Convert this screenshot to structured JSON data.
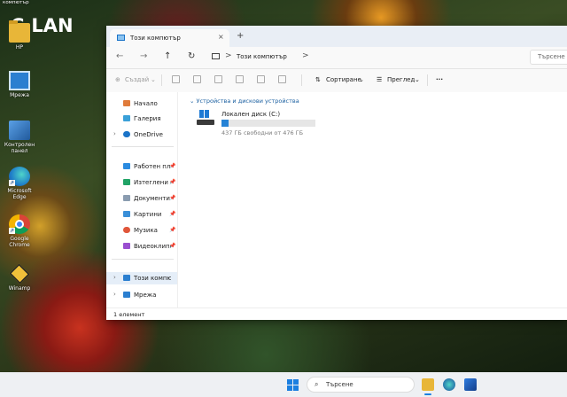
{
  "watermark": "C.LAN",
  "corner_label": "компютър",
  "desktop_icons": [
    {
      "label": "HP"
    },
    {
      "label": "Мрежа"
    },
    {
      "label": "Контролен панел"
    },
    {
      "label": "Microsoft Edge"
    },
    {
      "label": "Google Chrome"
    },
    {
      "label": "Winamp"
    }
  ],
  "window": {
    "tab_label": "Този компютър",
    "tab_close": "×",
    "tab_add": "+",
    "address_location": "Този компютър",
    "address_chevron": ">",
    "search_placeholder": "Търсене",
    "toolbar": {
      "new_label": "Създай",
      "sort_label": "Сортиране",
      "view_label": "Преглед",
      "more_label": "···"
    },
    "sidebar": {
      "items": [
        {
          "label": "Начало"
        },
        {
          "label": "Галерия"
        },
        {
          "label": "OneDrive"
        },
        {
          "label": "Работен плот"
        },
        {
          "label": "Изтеглени файлове"
        },
        {
          "label": "Документи"
        },
        {
          "label": "Картини"
        },
        {
          "label": "Музика"
        },
        {
          "label": "Видеоклипове"
        },
        {
          "label": "Този компютър"
        },
        {
          "label": "Мрежа"
        }
      ]
    },
    "group_heading": "Устройства и дискови устройства",
    "drive": {
      "name": "Локален диск (C:)",
      "free_text": "437 ГБ свободни от 476 ГБ",
      "used_fraction": 0.08
    },
    "status": "1 елемент"
  },
  "taskbar": {
    "search_placeholder": "Търсене"
  },
  "colors": {
    "accent": "#1b7fe0",
    "drive_bar": "#2683d6",
    "selection": "#e5eef8"
  }
}
